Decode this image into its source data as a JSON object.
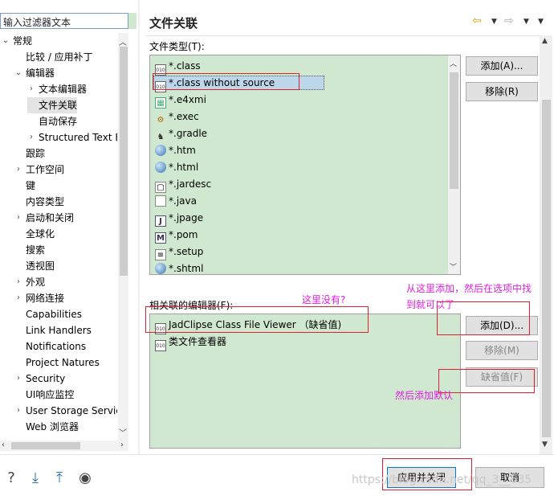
{
  "filter": {
    "placeholder": "输入过滤器文本"
  },
  "tree": [
    {
      "label": "常规",
      "twisty": "v"
    },
    {
      "label": "比较 / 应用补丁",
      "twisty": ""
    },
    {
      "label": "编辑器",
      "twisty": "v"
    },
    {
      "label": "文本编辑器",
      "twisty": ">"
    },
    {
      "label": "文件关联",
      "twisty": "",
      "selected": true
    },
    {
      "label": "自动保存",
      "twisty": ""
    },
    {
      "label": "Structured Text E",
      "twisty": ">"
    },
    {
      "label": "跟踪",
      "twisty": ""
    },
    {
      "label": "工作空间",
      "twisty": ">"
    },
    {
      "label": "键",
      "twisty": ""
    },
    {
      "label": "内容类型",
      "twisty": ""
    },
    {
      "label": "启动和关闭",
      "twisty": ">"
    },
    {
      "label": "全球化",
      "twisty": ""
    },
    {
      "label": "搜索",
      "twisty": ""
    },
    {
      "label": "透视图",
      "twisty": ""
    },
    {
      "label": "外观",
      "twisty": ">"
    },
    {
      "label": "网络连接",
      "twisty": ">"
    },
    {
      "label": "Capabilities",
      "twisty": ""
    },
    {
      "label": "Link Handlers",
      "twisty": ""
    },
    {
      "label": "Notifications",
      "twisty": ""
    },
    {
      "label": "Project Natures",
      "twisty": ""
    },
    {
      "label": "Security",
      "twisty": ">"
    },
    {
      "label": "UI响应监控",
      "twisty": ""
    },
    {
      "label": "User Storage Servic",
      "twisty": ">"
    },
    {
      "label": "Web 浏览器",
      "twisty": ""
    }
  ],
  "page": {
    "title": "文件关联"
  },
  "file_types": {
    "label": "文件类型(T):",
    "items": [
      {
        "name": "*.class",
        "icon": "class-file-icon"
      },
      {
        "name": "*.class without source",
        "icon": "class-file-icon"
      },
      {
        "name": "*.e4xmi",
        "icon": "grid-file-icon"
      },
      {
        "name": "*.exec",
        "icon": "gear-icon"
      },
      {
        "name": "*.gradle",
        "icon": "elephant-icon"
      },
      {
        "name": "*.htm",
        "icon": "globe-icon"
      },
      {
        "name": "*.html",
        "icon": "globe-icon"
      },
      {
        "name": "*.jardesc",
        "icon": "jar-icon"
      },
      {
        "name": "*.java",
        "icon": "document-icon"
      },
      {
        "name": "*.jpage",
        "icon": "j-file-icon"
      },
      {
        "name": "*.pom",
        "icon": "m-file-icon"
      },
      {
        "name": "*.setup",
        "icon": "setup-icon"
      },
      {
        "name": "*.shtml",
        "icon": "globe-icon"
      }
    ],
    "add_label": "添加(A)...",
    "remove_label": "移除(R)"
  },
  "editors": {
    "label": "相关联的编辑器(F):",
    "items": [
      {
        "name": "JadClipse Class File Viewer  （缺省值)",
        "icon": "class-file-icon"
      },
      {
        "name": "类文件查看器",
        "icon": "class-file-icon"
      }
    ],
    "add_label": "添加(D)...",
    "remove_label": "移除(M)",
    "default_label": "缺省值(F)"
  },
  "annotations": {
    "not_here": "这里没有?",
    "add_here_1": "从这里添加，然后在选项中找",
    "add_here_2": "到就可以了",
    "then_default": "然后添加默认"
  },
  "footer": {
    "apply_close": "应用并关闭",
    "cancel": "取消",
    "watermark": "https://blog.csdn.net/qq_3__635"
  }
}
